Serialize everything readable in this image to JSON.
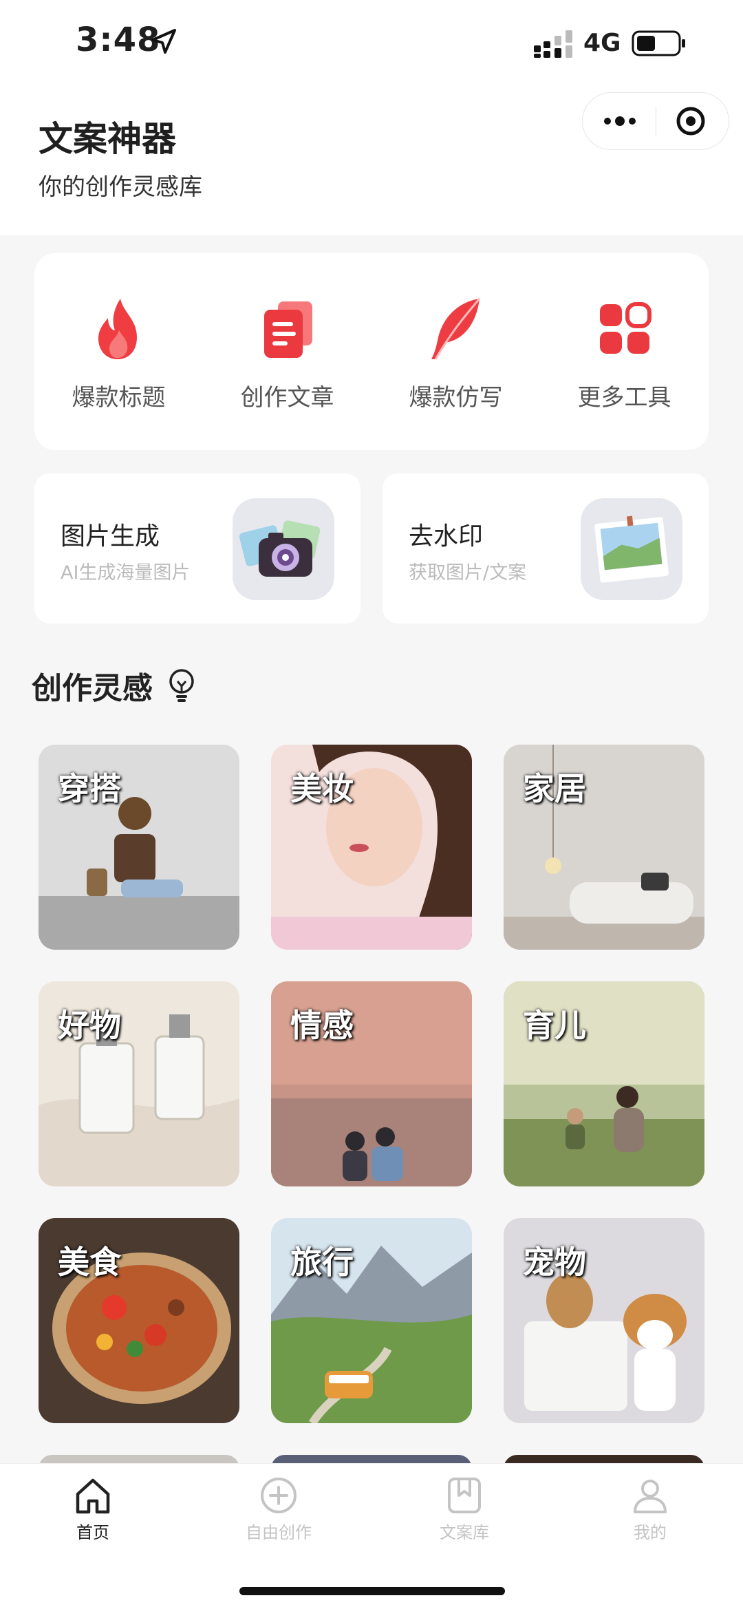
{
  "status_bar": {
    "time": "3:48",
    "network": "4G"
  },
  "header": {
    "title": "文案神器",
    "subtitle": "你的创作灵感库"
  },
  "tools": [
    {
      "label": "爆款标题",
      "icon": "flame-icon"
    },
    {
      "label": "创作文章",
      "icon": "document-icon"
    },
    {
      "label": "爆款仿写",
      "icon": "feather-icon"
    },
    {
      "label": "更多工具",
      "icon": "grid-icon"
    }
  ],
  "features": [
    {
      "title": "图片生成",
      "subtitle": "AI生成海量图片",
      "icon": "camera-icon"
    },
    {
      "title": "去水印",
      "subtitle": "获取图片/文案",
      "icon": "photo-icon"
    }
  ],
  "inspiration": {
    "title": "创作灵感",
    "categories": [
      {
        "label": "穿搭"
      },
      {
        "label": "美妆"
      },
      {
        "label": "家居"
      },
      {
        "label": "好物"
      },
      {
        "label": "情感"
      },
      {
        "label": "育儿"
      },
      {
        "label": "美食"
      },
      {
        "label": "旅行"
      },
      {
        "label": "宠物"
      }
    ]
  },
  "tabbar": [
    {
      "label": "首页",
      "icon": "home-icon",
      "active": true
    },
    {
      "label": "自由创作",
      "icon": "plus-circle-icon",
      "active": false
    },
    {
      "label": "文案库",
      "icon": "bookmark-icon",
      "active": false
    },
    {
      "label": "我的",
      "icon": "user-icon",
      "active": false
    }
  ],
  "colors": {
    "accent": "#e83a3f",
    "accent_light": "#f5686a",
    "active_tab": "#222222",
    "inactive_tab": "#c4c4c4"
  }
}
